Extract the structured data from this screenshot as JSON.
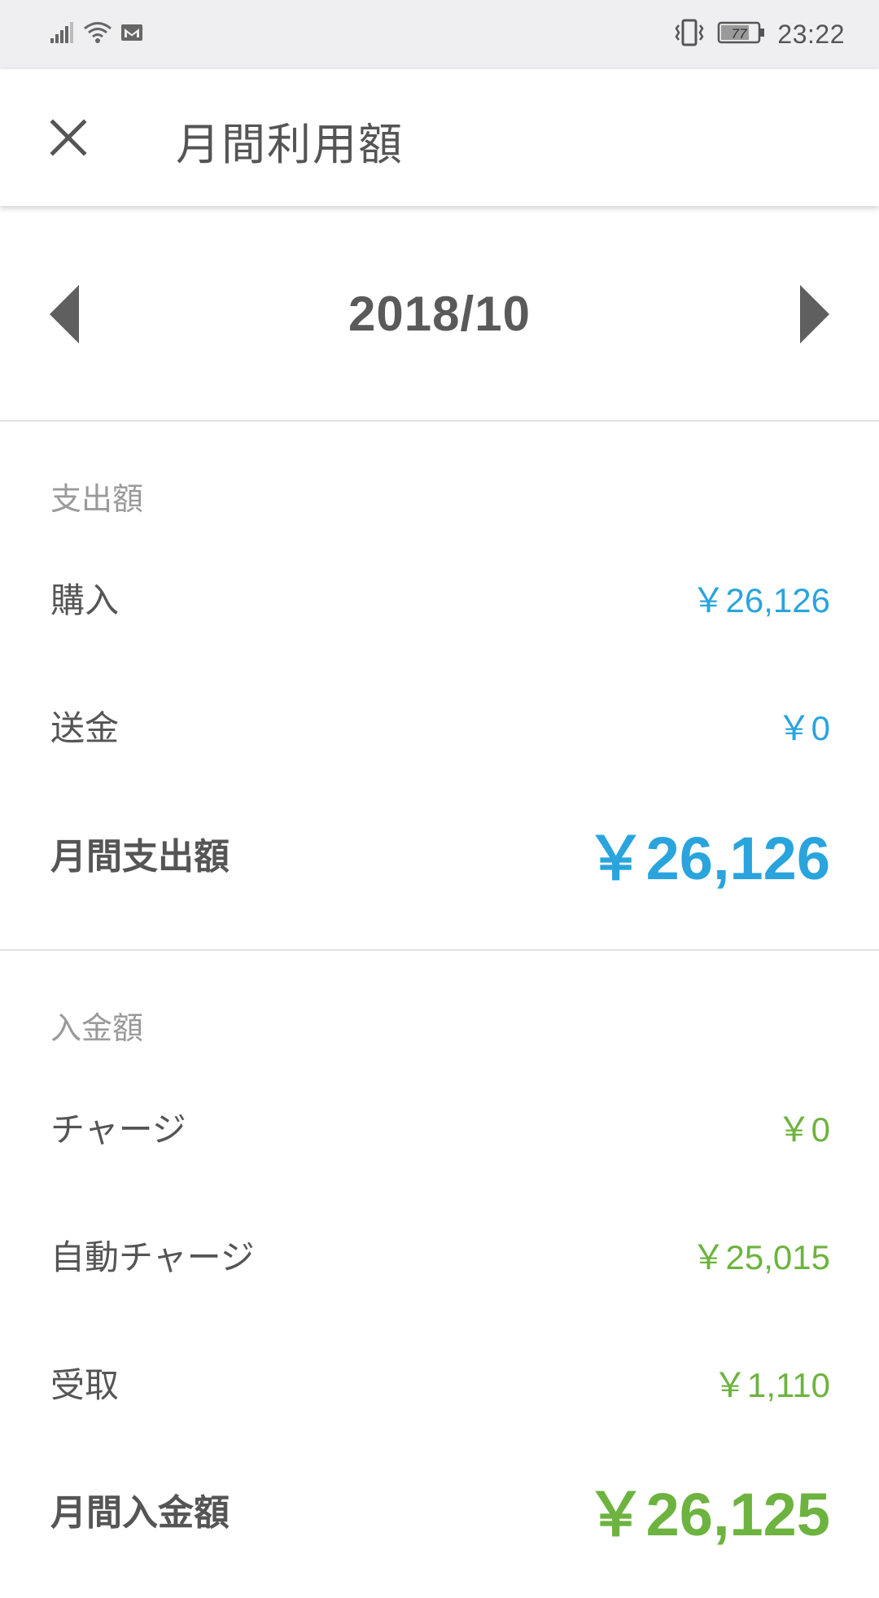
{
  "status_bar": {
    "time": "23:22",
    "battery_level": "77",
    "icons": [
      "signal-icon",
      "wifi-icon",
      "gmail-icon",
      "vibrate-icon",
      "battery-icon"
    ]
  },
  "header": {
    "title": "月間利用額",
    "close_icon": "close-icon"
  },
  "month_nav": {
    "month": "2018/10",
    "prev_icon": "triangle-left-icon",
    "next_icon": "triangle-right-icon"
  },
  "expense": {
    "header": "支出額",
    "rows": [
      {
        "label": "購入",
        "value": "￥26,126"
      },
      {
        "label": "送金",
        "value": "￥0"
      }
    ],
    "total_label": "月間支出額",
    "total_value": "￥26,126",
    "color": "#29a4dd"
  },
  "income": {
    "header": "入金額",
    "rows": [
      {
        "label": "チャージ",
        "value": "￥0"
      },
      {
        "label": "自動チャージ",
        "value": "￥25,015"
      },
      {
        "label": "受取",
        "value": "￥1,110"
      }
    ],
    "total_label": "月間入金額",
    "total_value": "￥26,125",
    "color": "#6db33f"
  }
}
